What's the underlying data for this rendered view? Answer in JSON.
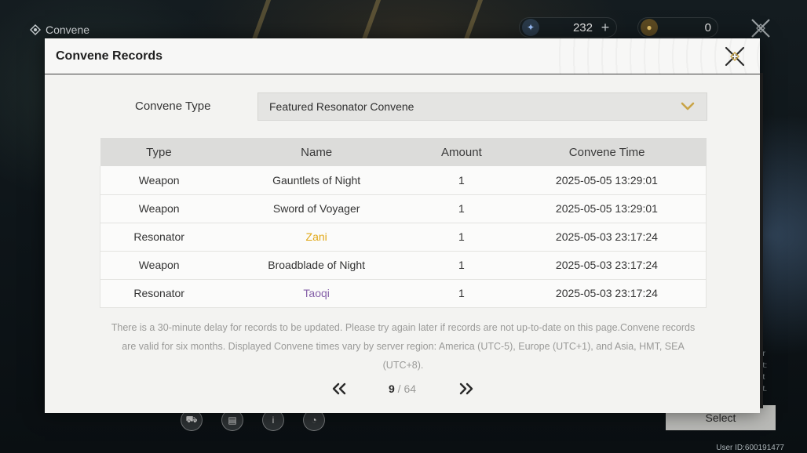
{
  "topbar": {
    "title": "Convene",
    "currency_1": {
      "icon": "astrite-icon",
      "value": "232",
      "plus": "+"
    },
    "currency_2": {
      "icon": "lustrous-tide-icon",
      "value": "0"
    }
  },
  "modal": {
    "title": "Convene Records",
    "type_label": "Convene Type",
    "type_value": "Featured Resonator Convene",
    "table": {
      "headers": [
        "Type",
        "Name",
        "Amount",
        "Convene Time"
      ],
      "rows": [
        {
          "type": "Weapon",
          "name": "Gauntlets of Night",
          "amount": "1",
          "time": "2025-05-05 13:29:01",
          "rarity": "normal"
        },
        {
          "type": "Weapon",
          "name": "Sword of Voyager",
          "amount": "1",
          "time": "2025-05-05 13:29:01",
          "rarity": "normal"
        },
        {
          "type": "Resonator",
          "name": "Zani",
          "amount": "1",
          "time": "2025-05-03 23:17:24",
          "rarity": "5-star"
        },
        {
          "type": "Weapon",
          "name": "Broadblade of Night",
          "amount": "1",
          "time": "2025-05-03 23:17:24",
          "rarity": "normal"
        },
        {
          "type": "Resonator",
          "name": "Taoqi",
          "amount": "1",
          "time": "2025-05-03 23:17:24",
          "rarity": "4-star"
        }
      ]
    },
    "note": "There is a 30-minute delay for records to be updated. Please try again later if records are not up-to-date on this page.Convene records are valid for six months. Displayed Convene times vary by server region: America (UTC-5), Europe (UTC+1), and Asia, HMT, SEA (UTC+8).",
    "pager": {
      "current": "9",
      "separator": " / ",
      "total": "64"
    }
  },
  "background": {
    "select_label": "Select",
    "user_id": "User ID:600191477",
    "side_text_lines": [
      "ar",
      "et:",
      "ot",
      "nt."
    ]
  },
  "colors": {
    "five_star": "#e1a817",
    "four_star": "#8560a8",
    "accent_gold": "#c9a447"
  }
}
